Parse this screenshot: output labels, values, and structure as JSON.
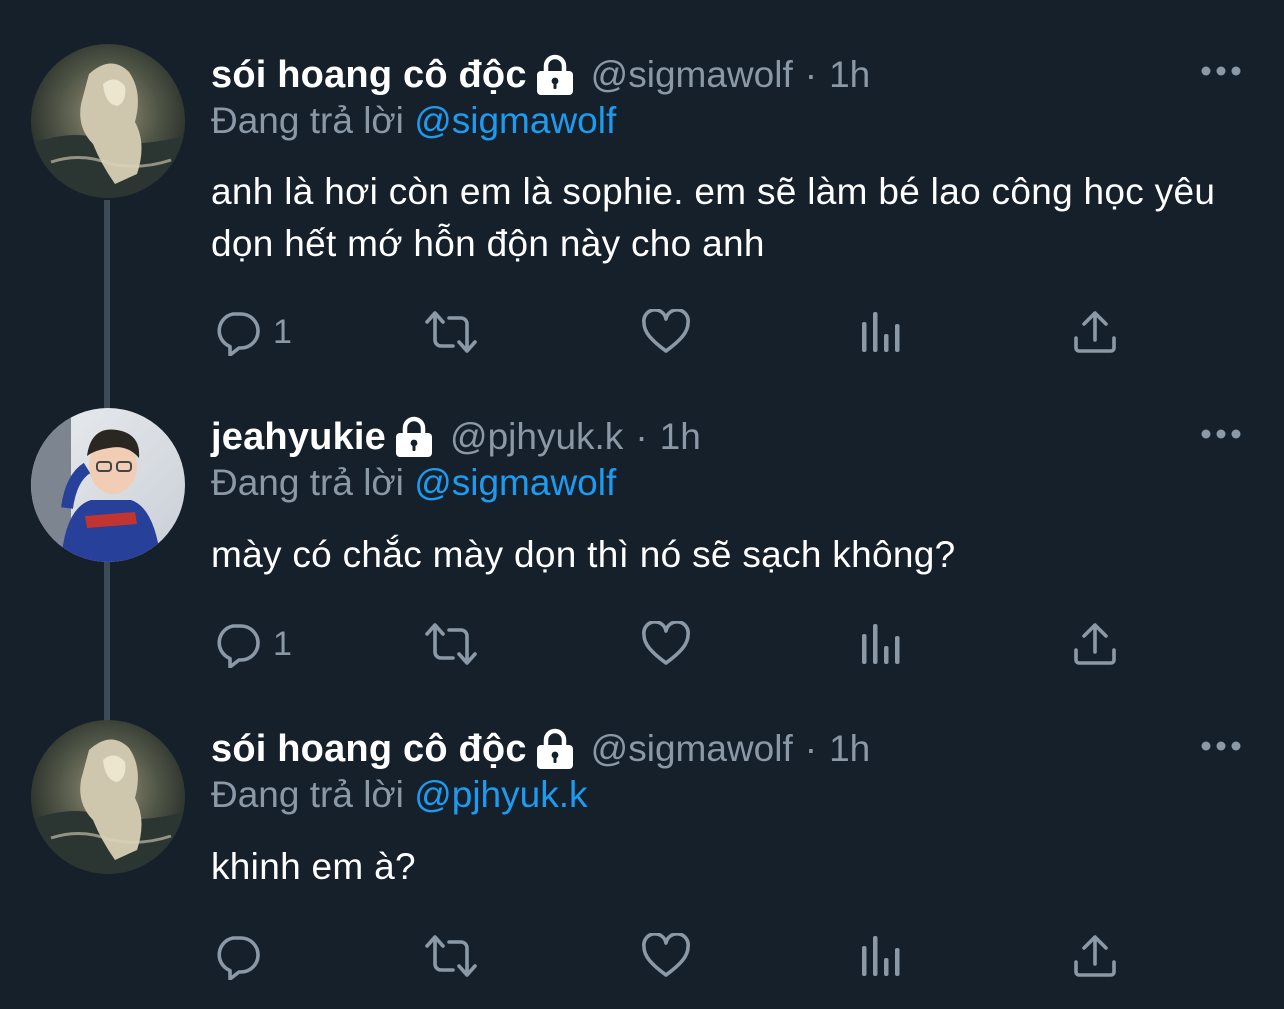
{
  "tweets": [
    {
      "name": "sói hoang cô độc",
      "handle": "@sigmawolf",
      "separator": "·",
      "time": "1h",
      "reply_prefix": "Đang trả lời",
      "reply_to": "@sigmawolf",
      "text": "anh là hơi còn em là sophie. em sẽ làm bé lao công học yêu dọn hết mớ hỗn độn này cho anh",
      "reply_count": "1"
    },
    {
      "name": "jeahyukie",
      "handle": "@pjhyuk.k",
      "separator": "·",
      "time": "1h",
      "reply_prefix": "Đang trả lời",
      "reply_to": "@sigmawolf",
      "text": "mày có chắc mày dọn thì nó sẽ sạch không?",
      "reply_count": "1"
    },
    {
      "name": "sói hoang cô độc",
      "handle": "@sigmawolf",
      "separator": "·",
      "time": "1h",
      "reply_prefix": "Đang trả lời",
      "reply_to": "@pjhyuk.k",
      "text": "khinh em à?",
      "reply_count": ""
    }
  ],
  "icons": {
    "lock": "lock-icon",
    "more": "more-options-icon",
    "reply": "reply-icon",
    "retweet": "retweet-icon",
    "like": "heart-icon",
    "views": "analytics-icon",
    "share": "share-icon"
  },
  "colors": {
    "background": "#15202b",
    "text": "#ffffff",
    "secondary": "#8b98a5",
    "mention": "#1d9bf0",
    "thread_line": "#3d4a57"
  }
}
